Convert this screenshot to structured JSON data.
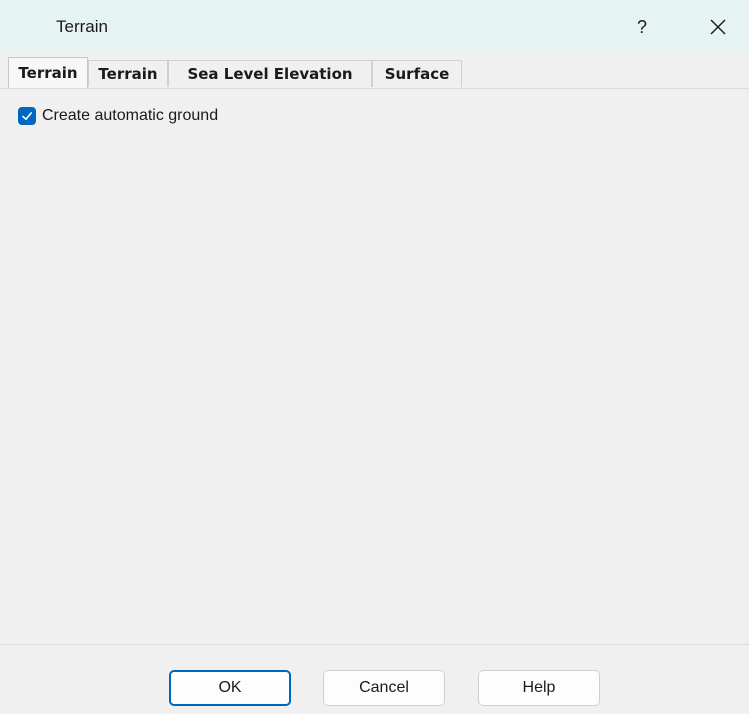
{
  "dialog": {
    "title": "Terrain",
    "help_label": "?"
  },
  "tabs": [
    {
      "label": "Terrain",
      "active": true
    },
    {
      "label": "Terrain",
      "active": false
    },
    {
      "label": "Sea Level Elevation",
      "active": false
    },
    {
      "label": "Surface",
      "active": false
    }
  ],
  "panel": {
    "auto_ground": {
      "label": "Create automatic ground",
      "checked": true
    }
  },
  "buttons": {
    "ok": "OK",
    "cancel": "Cancel",
    "help": "Help"
  },
  "colors": {
    "accent": "#0067c0",
    "titlebar": "#e6f3f3",
    "background": "#f0f0f0"
  },
  "icons": {
    "close": "close-icon",
    "check": "checkmark-icon"
  }
}
